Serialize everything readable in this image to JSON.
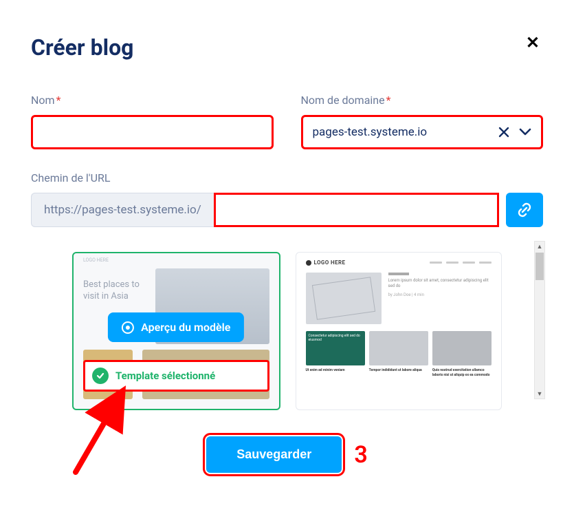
{
  "modal": {
    "title": "Créer blog",
    "close_aria": "Fermer"
  },
  "fields": {
    "name": {
      "label": "Nom",
      "value": ""
    },
    "domain": {
      "label": "Nom de domaine",
      "value": "pages-test.systeme.io"
    },
    "url": {
      "label": "Chemin de l'URL",
      "prefix": "https://pages-test.systeme.io/",
      "path": ""
    }
  },
  "templates": {
    "preview_label": "Aperçu du modèle",
    "selected_label": "Template sélectionné",
    "tpl1": {
      "hero_text": "Best places to visit in Asia",
      "brand": "LOGO HERE"
    },
    "tpl2": {
      "brand": "LOGO HERE",
      "feat_text": "Lorem ipsum dolor sit amet, consectetur adipiscing elit sed do",
      "g1": "Consectetur adipiscing elit sed do eiusmod",
      "r2a_title": "Ut enim ad minim veniam",
      "r2b_title": "Tempor indididunt ut labore aliqua",
      "r2c_title": "Quis nostrud exercitation ullamco laboris nisi ut aliquip ex ea commodo"
    }
  },
  "actions": {
    "save_label": "Sauvegarder"
  },
  "annotation": {
    "step_number": "3"
  }
}
